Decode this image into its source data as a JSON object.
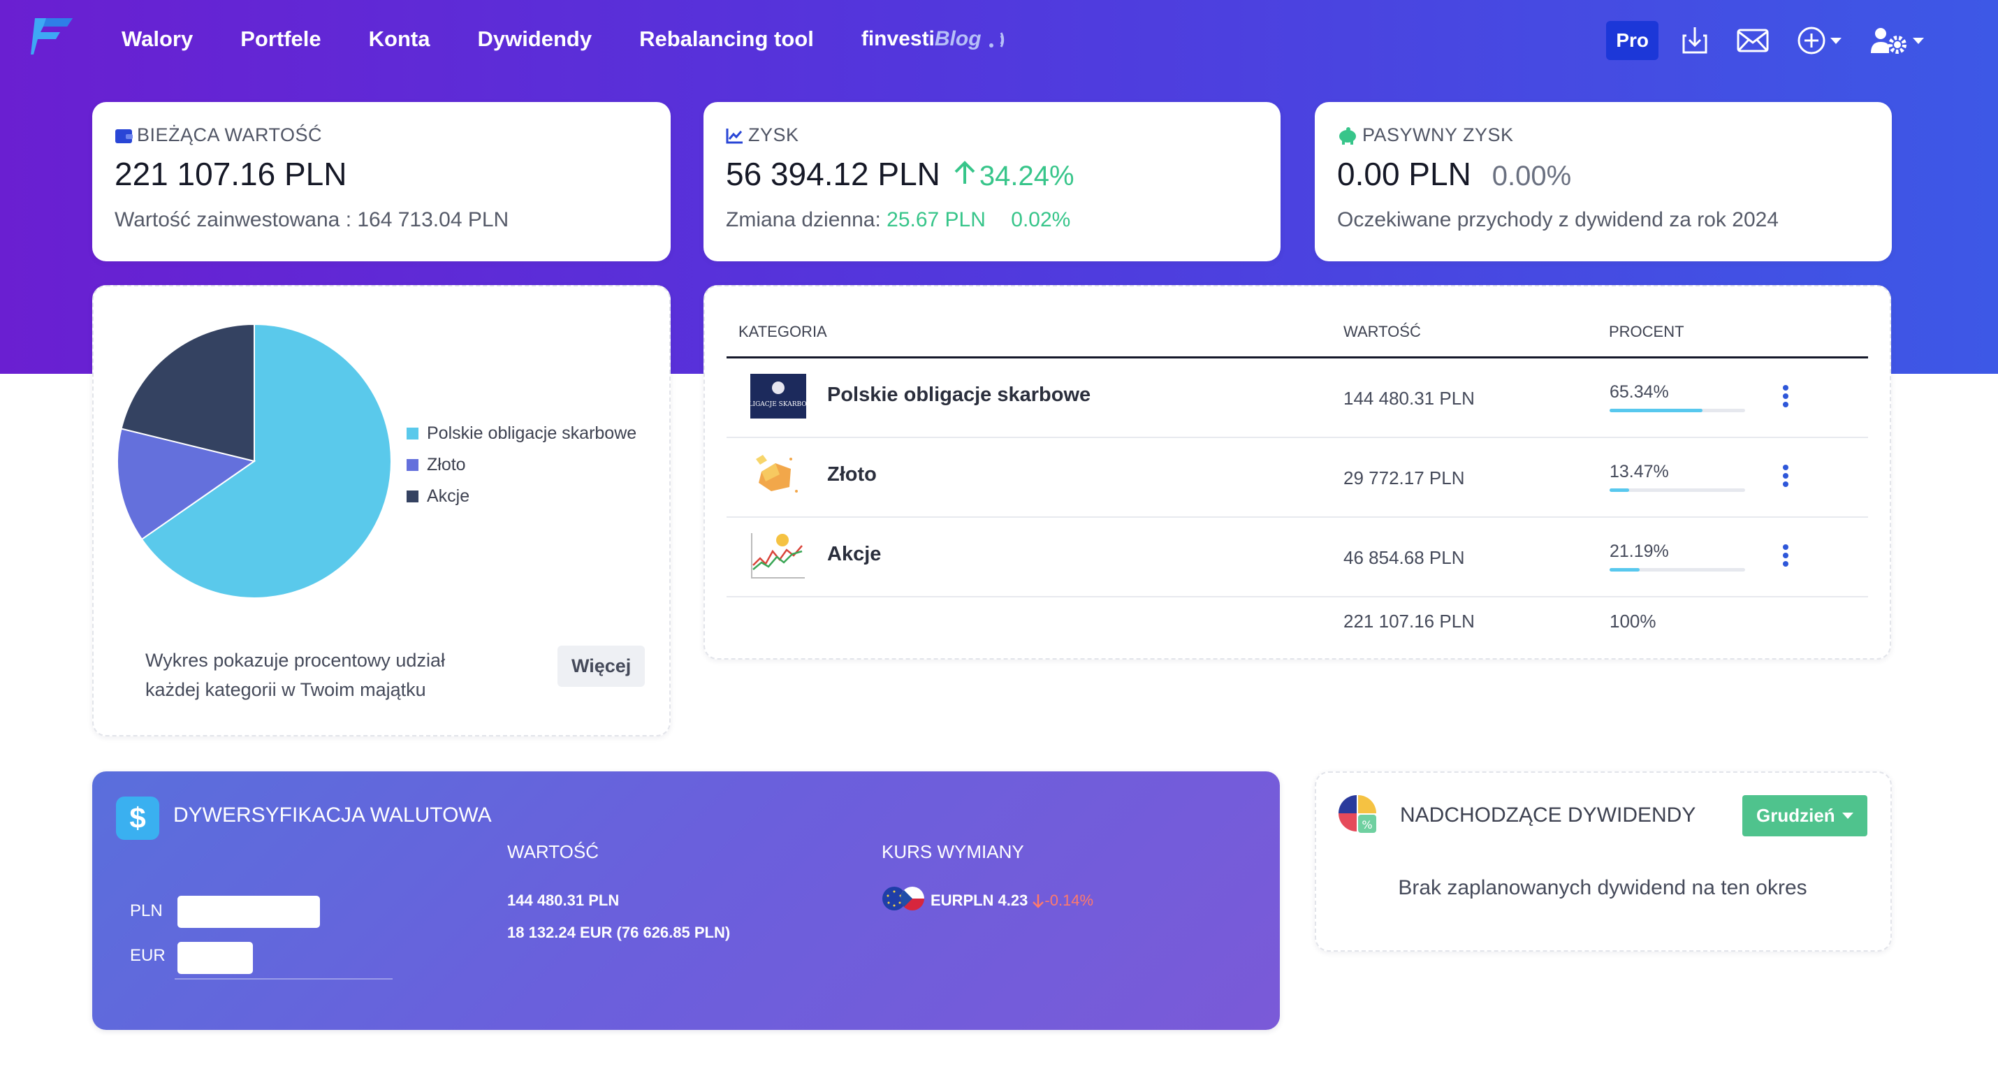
{
  "nav": {
    "items": [
      "Walory",
      "Portfele",
      "Konta",
      "Dywidendy",
      "Rebalancing tool"
    ],
    "blog_part1": "finvesti",
    "blog_part2": "Blog",
    "pro_label": "Pro"
  },
  "stats": {
    "current": {
      "label": "Bieżąca wartość",
      "value": "221 107.16 PLN",
      "sub_label": "Wartość zainwestowana : ",
      "sub_value": "164 713.04 PLN"
    },
    "profit": {
      "label": "Zysk",
      "value": "56 394.12 PLN",
      "pct": "34.24%",
      "sub_label": "Zmiana dzienna: ",
      "sub_value": "25.67 PLN",
      "sub_pct": "0.02%"
    },
    "passive": {
      "label": "Pasywny zysk",
      "value": "0.00 PLN",
      "pct": "0.00%",
      "sub": "Oczekiwane przychody z dywidend za rok 2024"
    }
  },
  "pie": {
    "legend": [
      "Polskie obligacje skarbowe",
      "Złoto",
      "Akcje"
    ],
    "description": "Wykres pokazuje procentowy udział każdej kategorii w Twoim majątku",
    "more_button": "Więcej"
  },
  "chart_data": {
    "type": "pie",
    "categories": [
      "Polskie obligacje skarbowe",
      "Złoto",
      "Akcje"
    ],
    "values": [
      65.34,
      13.47,
      21.19
    ],
    "colors": [
      "#5ac9eb",
      "#6470dc",
      "#344261"
    ],
    "legend_position": "right"
  },
  "table": {
    "headers": {
      "category": "Kategoria",
      "value": "Wartość",
      "percent": "Procent"
    },
    "rows": [
      {
        "name": "Polskie obligacje skarbowe",
        "value": "144 480.31 PLN",
        "pct": "65.34%",
        "fraction": 0.6534,
        "icon": "bonds-icon"
      },
      {
        "name": "Złoto",
        "value": "29 772.17 PLN",
        "pct": "13.47%",
        "fraction": 0.1347,
        "icon": "gold-icon"
      },
      {
        "name": "Akcje",
        "value": "46 854.68 PLN",
        "pct": "21.19%",
        "fraction": 0.2119,
        "icon": "stocks-icon"
      }
    ],
    "bond_logo_text": "OBLIGACJE SKARBOWE",
    "total_value": "221 107.16 PLN",
    "total_pct": "100%"
  },
  "currency": {
    "title": "Dywersyfikacja walutowa",
    "value_header": "Wartość",
    "rate_header": "Kurs wymiany",
    "bars": [
      {
        "label": "PLN",
        "fraction": 1.0
      },
      {
        "label": "EUR",
        "fraction": 0.53
      }
    ],
    "values": [
      "144 480.31 PLN",
      "18 132.24 EUR (76 626.85 PLN)"
    ],
    "rate_pair": "EURPLN 4.23",
    "rate_change": "-0.14%"
  },
  "dividends": {
    "title": "Nadchodzące dywidendy",
    "month_button": "Grudzień",
    "empty_text": "Brak zaplanowanych dywidend na ten okres"
  }
}
